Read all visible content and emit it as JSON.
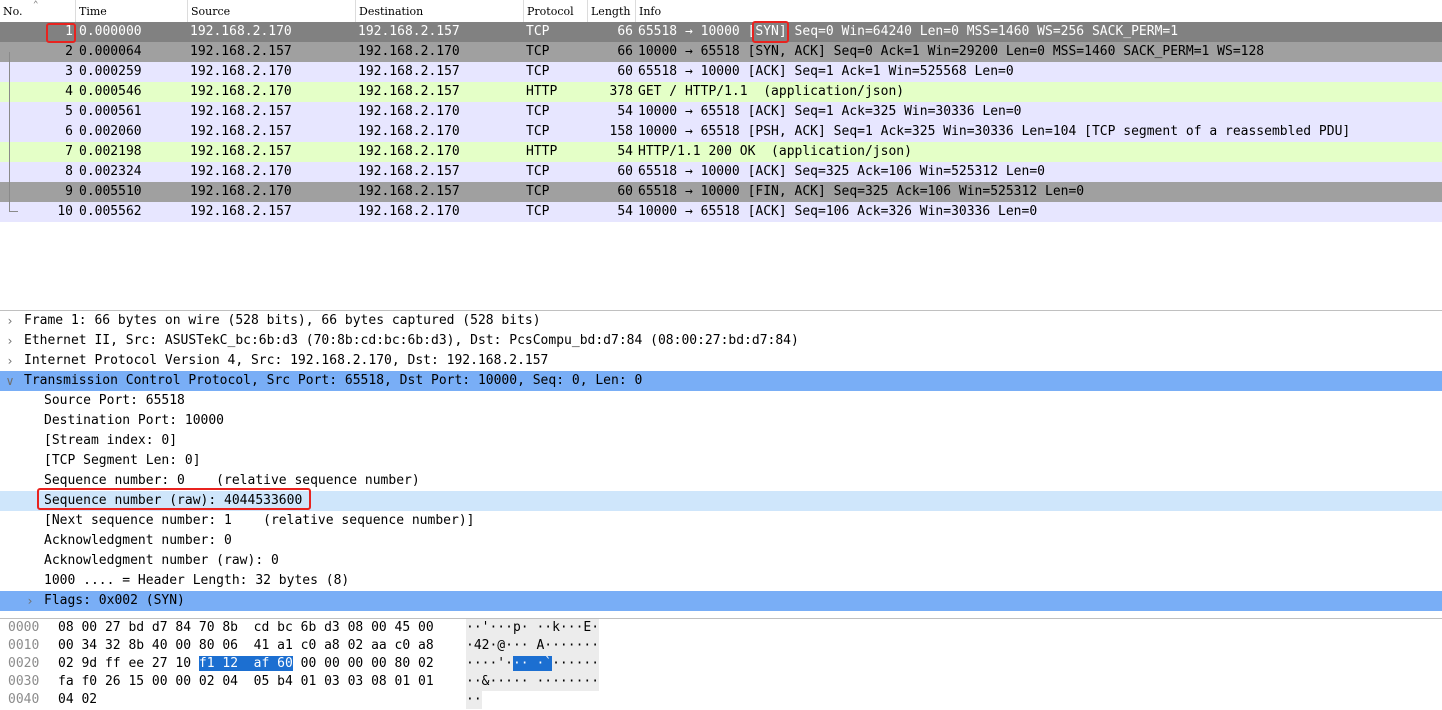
{
  "packet_list": {
    "columns": [
      "No.",
      "Time",
      "Source",
      "Destination",
      "Protocol",
      "Length",
      "Info"
    ],
    "rows": [
      {
        "no": "1",
        "time": "0.000000",
        "src": "192.168.2.170",
        "dst": "192.168.2.157",
        "proto": "TCP",
        "len": "66",
        "info": "65518 → 10000 ",
        "info_flag": "[SYN]",
        "info_rest": " Seq=0 Win=64240 Len=0 MSS=1460 WS=256 SACK_PERM=1",
        "bg": "#818181",
        "fg": "#ffffff"
      },
      {
        "no": "2",
        "time": "0.000064",
        "src": "192.168.2.157",
        "dst": "192.168.2.170",
        "proto": "TCP",
        "len": "66",
        "info": "10000 → 65518 [SYN, ACK] Seq=0 Ack=1 Win=29200 Len=0 MSS=1460 SACK_PERM=1 WS=128",
        "bg": "#a0a0a0",
        "fg": "#000000"
      },
      {
        "no": "3",
        "time": "0.000259",
        "src": "192.168.2.170",
        "dst": "192.168.2.157",
        "proto": "TCP",
        "len": "60",
        "info": "65518 → 10000 [ACK] Seq=1 Ack=1 Win=525568 Len=0",
        "bg": "#e7e6ff",
        "fg": "#000000"
      },
      {
        "no": "4",
        "time": "0.000546",
        "src": "192.168.2.170",
        "dst": "192.168.2.157",
        "proto": "HTTP",
        "len": "378",
        "info": "GET / HTTP/1.1  (application/json)",
        "bg": "#e4ffc7",
        "fg": "#000000"
      },
      {
        "no": "5",
        "time": "0.000561",
        "src": "192.168.2.157",
        "dst": "192.168.2.170",
        "proto": "TCP",
        "len": "54",
        "info": "10000 → 65518 [ACK] Seq=1 Ack=325 Win=30336 Len=0",
        "bg": "#e7e6ff",
        "fg": "#000000"
      },
      {
        "no": "6",
        "time": "0.002060",
        "src": "192.168.2.157",
        "dst": "192.168.2.170",
        "proto": "TCP",
        "len": "158",
        "info": "10000 → 65518 [PSH, ACK] Seq=1 Ack=325 Win=30336 Len=104 [TCP segment of a reassembled PDU]",
        "bg": "#e7e6ff",
        "fg": "#000000"
      },
      {
        "no": "7",
        "time": "0.002198",
        "src": "192.168.2.157",
        "dst": "192.168.2.170",
        "proto": "HTTP",
        "len": "54",
        "info": "HTTP/1.1 200 OK  (application/json)",
        "bg": "#e4ffc7",
        "fg": "#000000"
      },
      {
        "no": "8",
        "time": "0.002324",
        "src": "192.168.2.170",
        "dst": "192.168.2.157",
        "proto": "TCP",
        "len": "60",
        "info": "65518 → 10000 [ACK] Seq=325 Ack=106 Win=525312 Len=0",
        "bg": "#e7e6ff",
        "fg": "#000000"
      },
      {
        "no": "9",
        "time": "0.005510",
        "src": "192.168.2.170",
        "dst": "192.168.2.157",
        "proto": "TCP",
        "len": "60",
        "info": "65518 → 10000 [FIN, ACK] Seq=325 Ack=106 Win=525312 Len=0",
        "bg": "#a0a0a0",
        "fg": "#000000"
      },
      {
        "no": "10",
        "time": "0.005562",
        "src": "192.168.2.157",
        "dst": "192.168.2.170",
        "proto": "TCP",
        "len": "54",
        "info": "10000 → 65518 [ACK] Seq=106 Ack=326 Win=30336 Len=0",
        "bg": "#e7e6ff",
        "fg": "#000000"
      }
    ]
  },
  "details": {
    "rows": [
      {
        "indent": 0,
        "expander": "collapsed",
        "text": "Frame 1: 66 bytes on wire (528 bits), 66 bytes captured (528 bits)",
        "state": "normal"
      },
      {
        "indent": 0,
        "expander": "collapsed",
        "text": "Ethernet II, Src: ASUSTekC_bc:6b:d3 (70:8b:cd:bc:6b:d3), Dst: PcsCompu_bd:d7:84 (08:00:27:bd:d7:84)",
        "state": "normal"
      },
      {
        "indent": 0,
        "expander": "collapsed",
        "text": "Internet Protocol Version 4, Src: 192.168.2.170, Dst: 192.168.2.157",
        "state": "normal"
      },
      {
        "indent": 0,
        "expander": "expanded",
        "text": "Transmission Control Protocol, Src Port: 65518, Dst Port: 10000, Seq: 0, Len: 0",
        "state": "selected"
      },
      {
        "indent": 1,
        "expander": "none",
        "text": "Source Port: 65518",
        "state": "normal"
      },
      {
        "indent": 1,
        "expander": "none",
        "text": "Destination Port: 10000",
        "state": "normal"
      },
      {
        "indent": 1,
        "expander": "none",
        "text": "[Stream index: 0]",
        "state": "normal"
      },
      {
        "indent": 1,
        "expander": "none",
        "text": "[TCP Segment Len: 0]",
        "state": "normal"
      },
      {
        "indent": 1,
        "expander": "none",
        "text": "Sequence number: 0    (relative sequence number)",
        "state": "normal"
      },
      {
        "indent": 1,
        "expander": "none",
        "text": "Sequence number (raw): 4044533600",
        "state": "focused"
      },
      {
        "indent": 1,
        "expander": "none",
        "text": "[Next sequence number: 1    (relative sequence number)]",
        "state": "normal"
      },
      {
        "indent": 1,
        "expander": "none",
        "text": "Acknowledgment number: 0",
        "state": "normal"
      },
      {
        "indent": 1,
        "expander": "none",
        "text": "Acknowledgment number (raw): 0",
        "state": "normal"
      },
      {
        "indent": 1,
        "expander": "none",
        "text": "1000 .... = Header Length: 32 bytes (8)",
        "state": "normal"
      },
      {
        "indent": 1,
        "expander": "collapsed",
        "text": "Flags: 0x002 (SYN)",
        "state": "selected"
      }
    ]
  },
  "bytes": {
    "rows": [
      {
        "offset": "0000",
        "hex_a": "08 00 27 bd d7 84 70 8b  cd bc 6b d3 08 00 45 00",
        "ascii": "··'···p· ··k···E·"
      },
      {
        "offset": "0010",
        "hex_a": "00 34 32 8b 40 00 80 06  41 a1 c0 a8 02 aa c0 a8",
        "ascii": "·42·@··· A·······"
      },
      {
        "offset": "0020",
        "hex_a": "02 9d ff ee 27 10 ",
        "hex_hl": "f1 12  af 60",
        "hex_b": " 00 00 00 00 80 02",
        "ascii_a": "····'·",
        "ascii_hl": "·· ·`",
        "ascii_b": "······"
      },
      {
        "offset": "0030",
        "hex_a": "fa f0 26 15 00 00 02 04  05 b4 01 03 03 08 01 01",
        "ascii": "··&····· ········"
      },
      {
        "offset": "0040",
        "hex_a": "04 02",
        "ascii": "··"
      }
    ]
  },
  "colors": {
    "selected_detail": "#79aef6",
    "focused_detail": "#cfe6fb",
    "annotation": "#e8231f"
  }
}
